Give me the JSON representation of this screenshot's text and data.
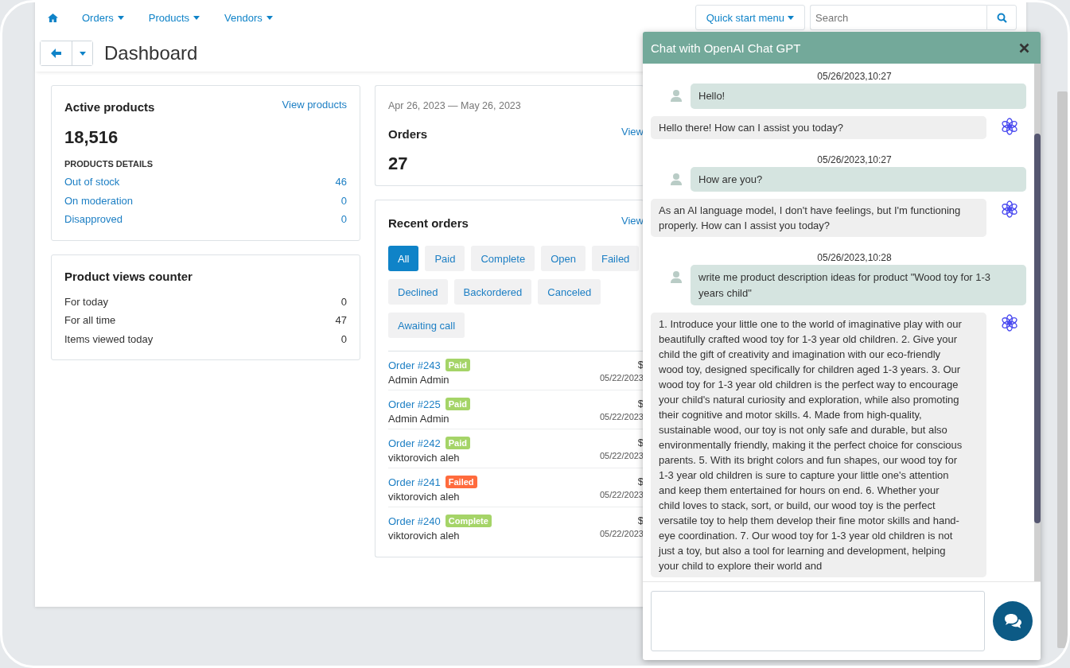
{
  "nav": {
    "items": [
      {
        "label": "Orders"
      },
      {
        "label": "Products"
      },
      {
        "label": "Vendors"
      }
    ],
    "quick_start": "Quick start menu",
    "search_placeholder": "Search"
  },
  "page_title": "Dashboard",
  "active_products": {
    "title": "Active products",
    "link": "View products",
    "count": "18,516",
    "details_heading": "PRODUCTS DETAILS",
    "details": [
      {
        "label": "Out of stock",
        "value": "46"
      },
      {
        "label": "On moderation",
        "value": "0"
      },
      {
        "label": "Disapproved",
        "value": "0"
      }
    ]
  },
  "views": {
    "title": "Product views counter",
    "rows": [
      {
        "label": "For today",
        "value": "0"
      },
      {
        "label": "For all time",
        "value": "47"
      },
      {
        "label": "Items viewed today",
        "value": "0"
      }
    ]
  },
  "orders_summary": {
    "date_range": "Apr 26, 2023 — May 26, 2023",
    "title": "Orders",
    "link": "View",
    "count": "27"
  },
  "recent_orders": {
    "title": "Recent orders",
    "link": "View",
    "filters": [
      {
        "label": "All",
        "selected": true
      },
      {
        "label": "Paid",
        "selected": false
      },
      {
        "label": "Complete",
        "selected": false
      },
      {
        "label": "Open",
        "selected": false
      },
      {
        "label": "Failed",
        "selected": false
      },
      {
        "label": "Declined",
        "selected": false
      },
      {
        "label": "Backordered",
        "selected": false
      },
      {
        "label": "Canceled",
        "selected": false
      },
      {
        "label": "Awaiting call",
        "selected": false
      }
    ],
    "orders": [
      {
        "number": "Order #243",
        "status": "Paid",
        "color": "#a5d468",
        "customer": "Admin Admin",
        "amount": "$",
        "date": "05/22/2023"
      },
      {
        "number": "Order #225",
        "status": "Paid",
        "color": "#a5d468",
        "customer": "Admin Admin",
        "amount": "$",
        "date": "05/22/2023"
      },
      {
        "number": "Order #242",
        "status": "Paid",
        "color": "#a5d468",
        "customer": "viktorovich aleh",
        "amount": "$",
        "date": "05/22/2023"
      },
      {
        "number": "Order #241",
        "status": "Failed",
        "color": "#ff6b3d",
        "customer": "viktorovich aleh",
        "amount": "$",
        "date": "05/22/2023"
      },
      {
        "number": "Order #240",
        "status": "Complete",
        "color": "#a5d468",
        "customer": "viktorovich aleh",
        "amount": "$",
        "date": "05/22/2023"
      }
    ]
  },
  "chat": {
    "title": "Chat with OpenAI Chat GPT",
    "messages": [
      {
        "kind": "timestamp",
        "text": "05/26/2023,10:27"
      },
      {
        "kind": "user",
        "text": "Hello!"
      },
      {
        "kind": "bot",
        "text": "Hello there! How can I assist you today?"
      },
      {
        "kind": "timestamp",
        "text": "05/26/2023,10:27"
      },
      {
        "kind": "user",
        "text": "How are you?"
      },
      {
        "kind": "bot",
        "text": "As an AI language model, I don't have feelings, but I'm functioning properly. How can I assist you today?"
      },
      {
        "kind": "timestamp",
        "text": "05/26/2023,10:28"
      },
      {
        "kind": "user",
        "text": "write me product description ideas for product \"Wood toy for 1-3 years child\""
      },
      {
        "kind": "bot",
        "text": "1. Introduce your little one to the world of imaginative play with our beautifully crafted wood toy for 1-3 year old children. 2. Give your child the gift of creativity and imagination with our eco-friendly wood toy, designed specifically for children aged 1-3 years. 3. Our wood toy for 1-3 year old children is the perfect way to encourage your child's natural curiosity and exploration, while also promoting their cognitive and motor skills. 4. Made from high-quality, sustainable wood, our toy is not only safe and durable, but also environmentally friendly, making it the perfect choice for conscious parents. 5. With its bright colors and fun shapes, our wood toy for 1-3 year old children is sure to capture your little one's attention and keep them entertained for hours on end. 6. Whether your child loves to stack, sort, or build, our wood toy is the perfect versatile toy to help them develop their fine motor skills and hand-eye coordination. 7. Our wood toy for 1-3 year old children is not just a toy, but also a tool for learning and development, helping your child to explore their world and"
      }
    ]
  }
}
